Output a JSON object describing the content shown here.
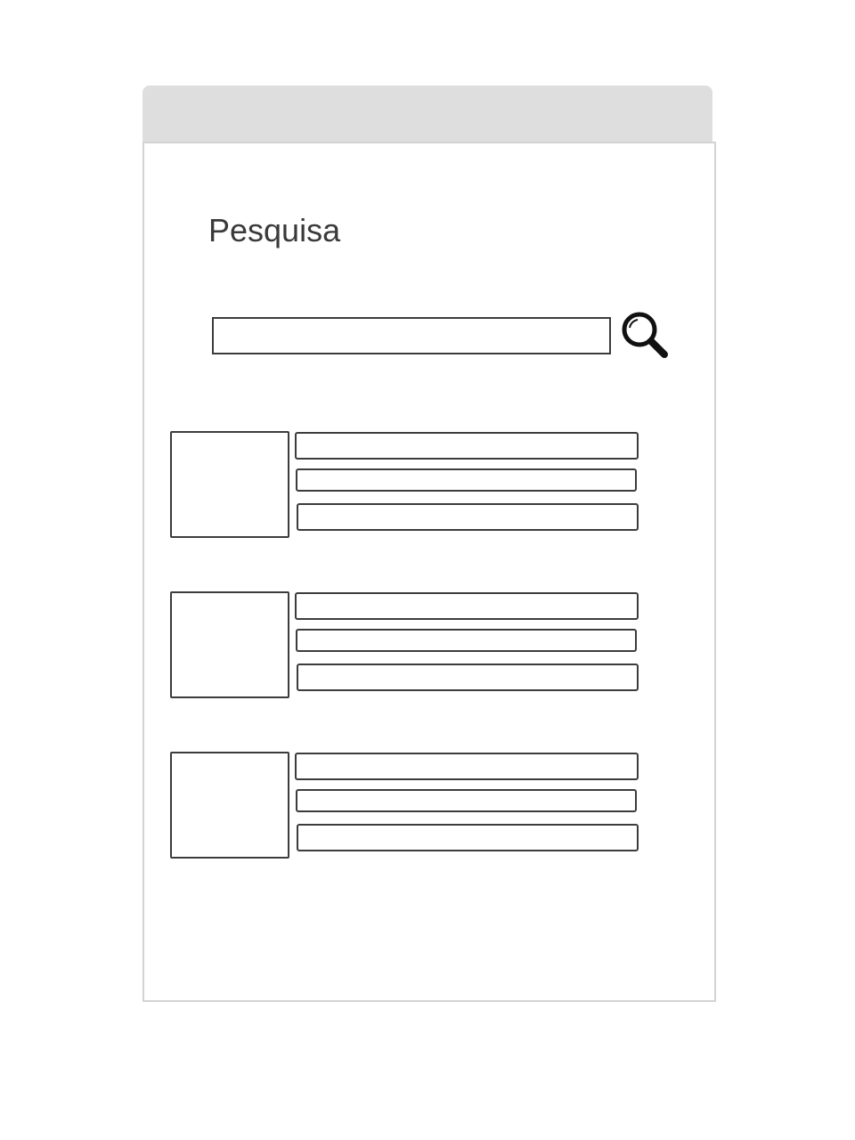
{
  "page": {
    "title": "Pesquisa"
  },
  "search": {
    "value": "",
    "placeholder": ""
  },
  "icons": {
    "search": "search-icon"
  },
  "results": [
    {
      "thumbnail": "",
      "line1": "",
      "line2": "",
      "line3": ""
    },
    {
      "thumbnail": "",
      "line1": "",
      "line2": "",
      "line3": ""
    },
    {
      "thumbnail": "",
      "line1": "",
      "line2": "",
      "line3": ""
    }
  ],
  "colors": {
    "header": "#dedede",
    "frame_border": "#d3d3d3",
    "stroke": "#3c3c3c",
    "title_text": "#3a3a3a"
  }
}
